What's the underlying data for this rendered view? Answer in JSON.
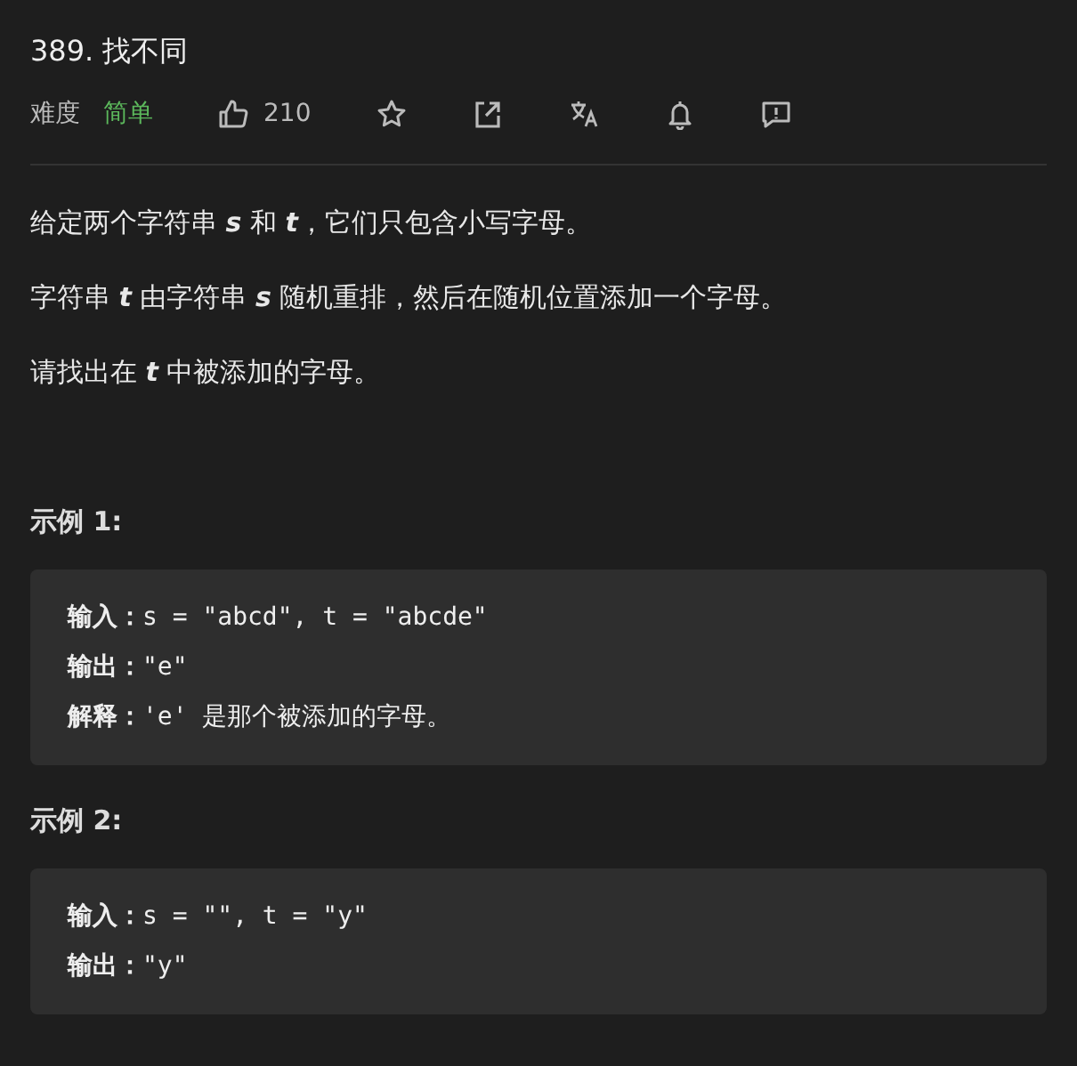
{
  "title": "389. 找不同",
  "meta": {
    "difficulty_label": "难度",
    "difficulty": "简单",
    "actions": [
      {
        "kind": "like",
        "count": "210"
      },
      {
        "kind": "star"
      },
      {
        "kind": "share"
      },
      {
        "kind": "translate"
      },
      {
        "kind": "bell"
      },
      {
        "kind": "feedback"
      }
    ]
  },
  "description": [
    "给定两个字符串 **s** 和 **t**，它们只包含小写字母。",
    "字符串 **t** 由字符串 **s** 随机重排，然后在随机位置添加一个字母。",
    "请找出在 **t** 中被添加的字母。"
  ],
  "examples": [
    {
      "heading": "示例 1:",
      "lines": [
        "**输入：**s = \"abcd\", t = \"abcde\"",
        "**输出：**\"e\"",
        "**解释：**'e' 是那个被添加的字母。"
      ]
    },
    {
      "heading": "示例 2:",
      "lines": [
        "**输入：**s = \"\", t = \"y\"",
        "**输出：**\"y\""
      ]
    }
  ]
}
